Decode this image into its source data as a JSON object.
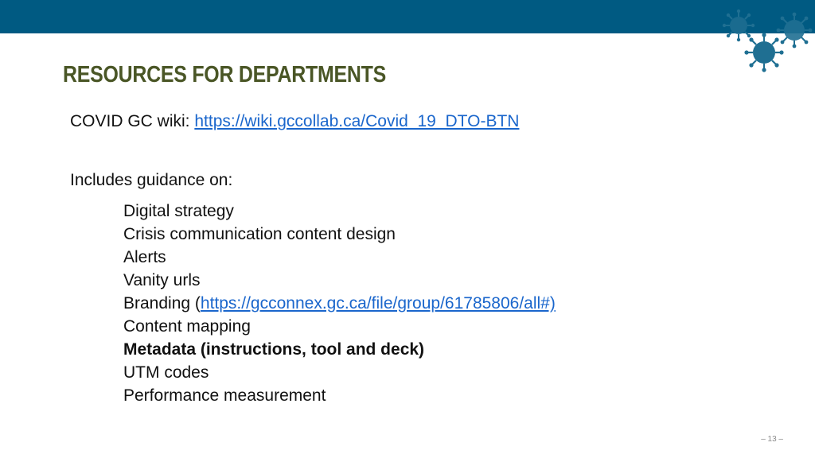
{
  "slide": {
    "title": "RESOURCES FOR DEPARTMENTS",
    "wiki_label": "COVID GC wiki: ",
    "wiki_url": "https://wiki.gccollab.ca/Covid_19_DTO-BTN",
    "includes_heading": "Includes guidance on:",
    "guidance": {
      "digital_strategy": "Digital strategy",
      "crisis_content": "Crisis communication content design",
      "alerts": "Alerts",
      "vanity_urls": "Vanity urls",
      "branding_prefix": "Branding (",
      "branding_url": "https://gcconnex.gc.ca/file/group/61785806/all#)",
      "content_mapping": "Content mapping",
      "metadata": "Metadata (instructions, tool and deck)",
      "utm_codes": "UTM codes",
      "performance": "Performance measurement"
    },
    "page_number": "– 13 –"
  },
  "theme": {
    "band_color": "#005a82",
    "title_color": "#4a5626",
    "link_color": "#1a66cc",
    "virus_color": "#1f6f92"
  },
  "icons": {
    "decor": "coronavirus-icon"
  }
}
